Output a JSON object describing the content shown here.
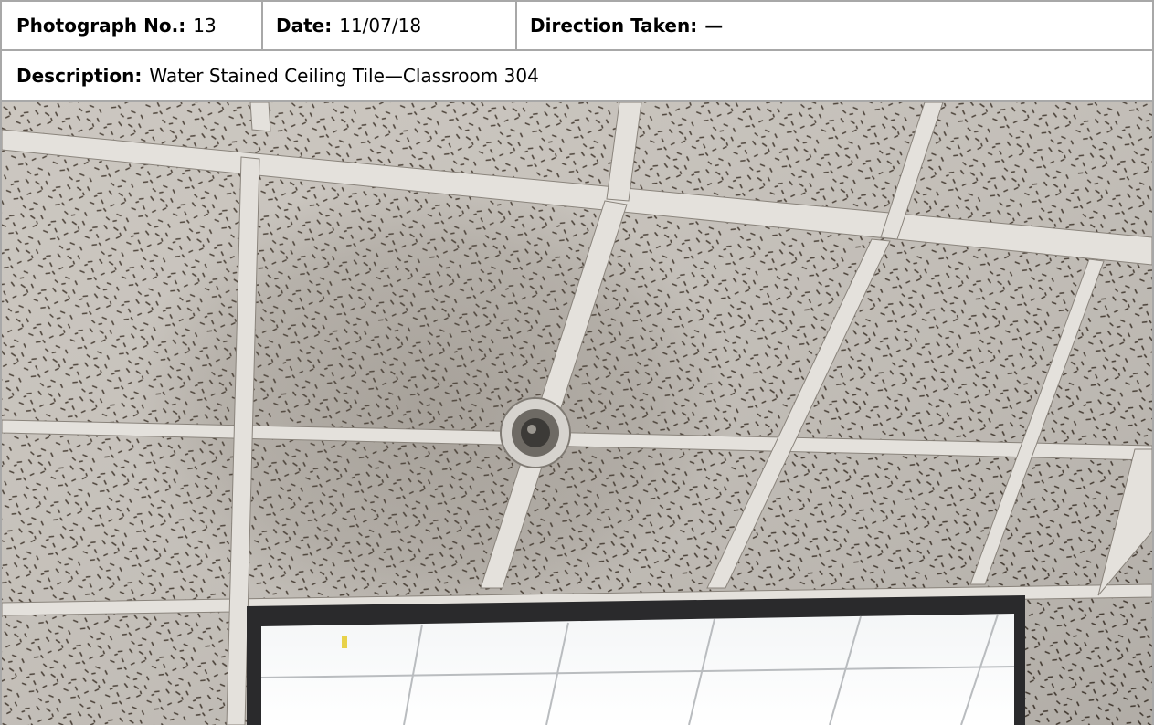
{
  "header": {
    "photo_no_label": "Photograph No.:",
    "photo_no_value": "13",
    "date_label": "Date:",
    "date_value": "11/07/18",
    "direction_label": "Direction Taken:",
    "direction_value": "—"
  },
  "description": {
    "label": "Description:",
    "value": "Water Stained Ceiling Tile—Classroom 304"
  },
  "photo": {
    "subject": "ceiling-tiles-with-water-stain-and-sprinkler"
  }
}
